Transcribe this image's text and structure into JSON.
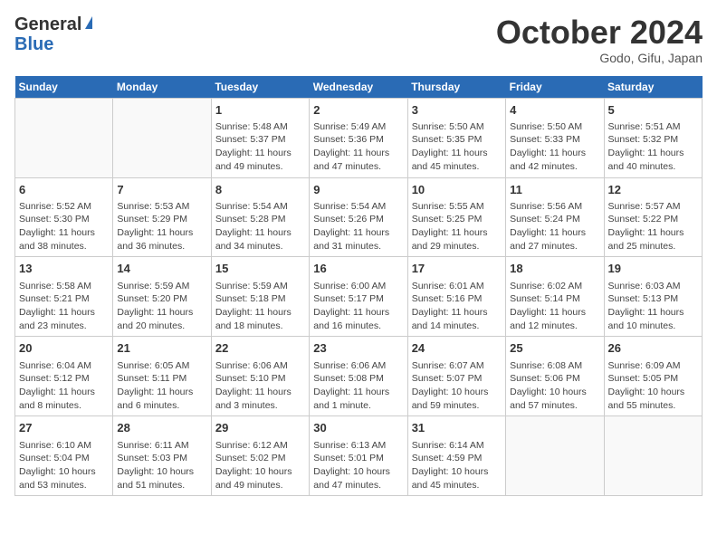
{
  "header": {
    "logo_general": "General",
    "logo_blue": "Blue",
    "month": "October 2024",
    "location": "Godo, Gifu, Japan"
  },
  "weekdays": [
    "Sunday",
    "Monday",
    "Tuesday",
    "Wednesday",
    "Thursday",
    "Friday",
    "Saturday"
  ],
  "weeks": [
    [
      {
        "day": "",
        "sunrise": "",
        "sunset": "",
        "daylight": ""
      },
      {
        "day": "",
        "sunrise": "",
        "sunset": "",
        "daylight": ""
      },
      {
        "day": "1",
        "sunrise": "Sunrise: 5:48 AM",
        "sunset": "Sunset: 5:37 PM",
        "daylight": "Daylight: 11 hours and 49 minutes."
      },
      {
        "day": "2",
        "sunrise": "Sunrise: 5:49 AM",
        "sunset": "Sunset: 5:36 PM",
        "daylight": "Daylight: 11 hours and 47 minutes."
      },
      {
        "day": "3",
        "sunrise": "Sunrise: 5:50 AM",
        "sunset": "Sunset: 5:35 PM",
        "daylight": "Daylight: 11 hours and 45 minutes."
      },
      {
        "day": "4",
        "sunrise": "Sunrise: 5:50 AM",
        "sunset": "Sunset: 5:33 PM",
        "daylight": "Daylight: 11 hours and 42 minutes."
      },
      {
        "day": "5",
        "sunrise": "Sunrise: 5:51 AM",
        "sunset": "Sunset: 5:32 PM",
        "daylight": "Daylight: 11 hours and 40 minutes."
      }
    ],
    [
      {
        "day": "6",
        "sunrise": "Sunrise: 5:52 AM",
        "sunset": "Sunset: 5:30 PM",
        "daylight": "Daylight: 11 hours and 38 minutes."
      },
      {
        "day": "7",
        "sunrise": "Sunrise: 5:53 AM",
        "sunset": "Sunset: 5:29 PM",
        "daylight": "Daylight: 11 hours and 36 minutes."
      },
      {
        "day": "8",
        "sunrise": "Sunrise: 5:54 AM",
        "sunset": "Sunset: 5:28 PM",
        "daylight": "Daylight: 11 hours and 34 minutes."
      },
      {
        "day": "9",
        "sunrise": "Sunrise: 5:54 AM",
        "sunset": "Sunset: 5:26 PM",
        "daylight": "Daylight: 11 hours and 31 minutes."
      },
      {
        "day": "10",
        "sunrise": "Sunrise: 5:55 AM",
        "sunset": "Sunset: 5:25 PM",
        "daylight": "Daylight: 11 hours and 29 minutes."
      },
      {
        "day": "11",
        "sunrise": "Sunrise: 5:56 AM",
        "sunset": "Sunset: 5:24 PM",
        "daylight": "Daylight: 11 hours and 27 minutes."
      },
      {
        "day": "12",
        "sunrise": "Sunrise: 5:57 AM",
        "sunset": "Sunset: 5:22 PM",
        "daylight": "Daylight: 11 hours and 25 minutes."
      }
    ],
    [
      {
        "day": "13",
        "sunrise": "Sunrise: 5:58 AM",
        "sunset": "Sunset: 5:21 PM",
        "daylight": "Daylight: 11 hours and 23 minutes."
      },
      {
        "day": "14",
        "sunrise": "Sunrise: 5:59 AM",
        "sunset": "Sunset: 5:20 PM",
        "daylight": "Daylight: 11 hours and 20 minutes."
      },
      {
        "day": "15",
        "sunrise": "Sunrise: 5:59 AM",
        "sunset": "Sunset: 5:18 PM",
        "daylight": "Daylight: 11 hours and 18 minutes."
      },
      {
        "day": "16",
        "sunrise": "Sunrise: 6:00 AM",
        "sunset": "Sunset: 5:17 PM",
        "daylight": "Daylight: 11 hours and 16 minutes."
      },
      {
        "day": "17",
        "sunrise": "Sunrise: 6:01 AM",
        "sunset": "Sunset: 5:16 PM",
        "daylight": "Daylight: 11 hours and 14 minutes."
      },
      {
        "day": "18",
        "sunrise": "Sunrise: 6:02 AM",
        "sunset": "Sunset: 5:14 PM",
        "daylight": "Daylight: 11 hours and 12 minutes."
      },
      {
        "day": "19",
        "sunrise": "Sunrise: 6:03 AM",
        "sunset": "Sunset: 5:13 PM",
        "daylight": "Daylight: 11 hours and 10 minutes."
      }
    ],
    [
      {
        "day": "20",
        "sunrise": "Sunrise: 6:04 AM",
        "sunset": "Sunset: 5:12 PM",
        "daylight": "Daylight: 11 hours and 8 minutes."
      },
      {
        "day": "21",
        "sunrise": "Sunrise: 6:05 AM",
        "sunset": "Sunset: 5:11 PM",
        "daylight": "Daylight: 11 hours and 6 minutes."
      },
      {
        "day": "22",
        "sunrise": "Sunrise: 6:06 AM",
        "sunset": "Sunset: 5:10 PM",
        "daylight": "Daylight: 11 hours and 3 minutes."
      },
      {
        "day": "23",
        "sunrise": "Sunrise: 6:06 AM",
        "sunset": "Sunset: 5:08 PM",
        "daylight": "Daylight: 11 hours and 1 minute."
      },
      {
        "day": "24",
        "sunrise": "Sunrise: 6:07 AM",
        "sunset": "Sunset: 5:07 PM",
        "daylight": "Daylight: 10 hours and 59 minutes."
      },
      {
        "day": "25",
        "sunrise": "Sunrise: 6:08 AM",
        "sunset": "Sunset: 5:06 PM",
        "daylight": "Daylight: 10 hours and 57 minutes."
      },
      {
        "day": "26",
        "sunrise": "Sunrise: 6:09 AM",
        "sunset": "Sunset: 5:05 PM",
        "daylight": "Daylight: 10 hours and 55 minutes."
      }
    ],
    [
      {
        "day": "27",
        "sunrise": "Sunrise: 6:10 AM",
        "sunset": "Sunset: 5:04 PM",
        "daylight": "Daylight: 10 hours and 53 minutes."
      },
      {
        "day": "28",
        "sunrise": "Sunrise: 6:11 AM",
        "sunset": "Sunset: 5:03 PM",
        "daylight": "Daylight: 10 hours and 51 minutes."
      },
      {
        "day": "29",
        "sunrise": "Sunrise: 6:12 AM",
        "sunset": "Sunset: 5:02 PM",
        "daylight": "Daylight: 10 hours and 49 minutes."
      },
      {
        "day": "30",
        "sunrise": "Sunrise: 6:13 AM",
        "sunset": "Sunset: 5:01 PM",
        "daylight": "Daylight: 10 hours and 47 minutes."
      },
      {
        "day": "31",
        "sunrise": "Sunrise: 6:14 AM",
        "sunset": "Sunset: 4:59 PM",
        "daylight": "Daylight: 10 hours and 45 minutes."
      },
      {
        "day": "",
        "sunrise": "",
        "sunset": "",
        "daylight": ""
      },
      {
        "day": "",
        "sunrise": "",
        "sunset": "",
        "daylight": ""
      }
    ]
  ]
}
